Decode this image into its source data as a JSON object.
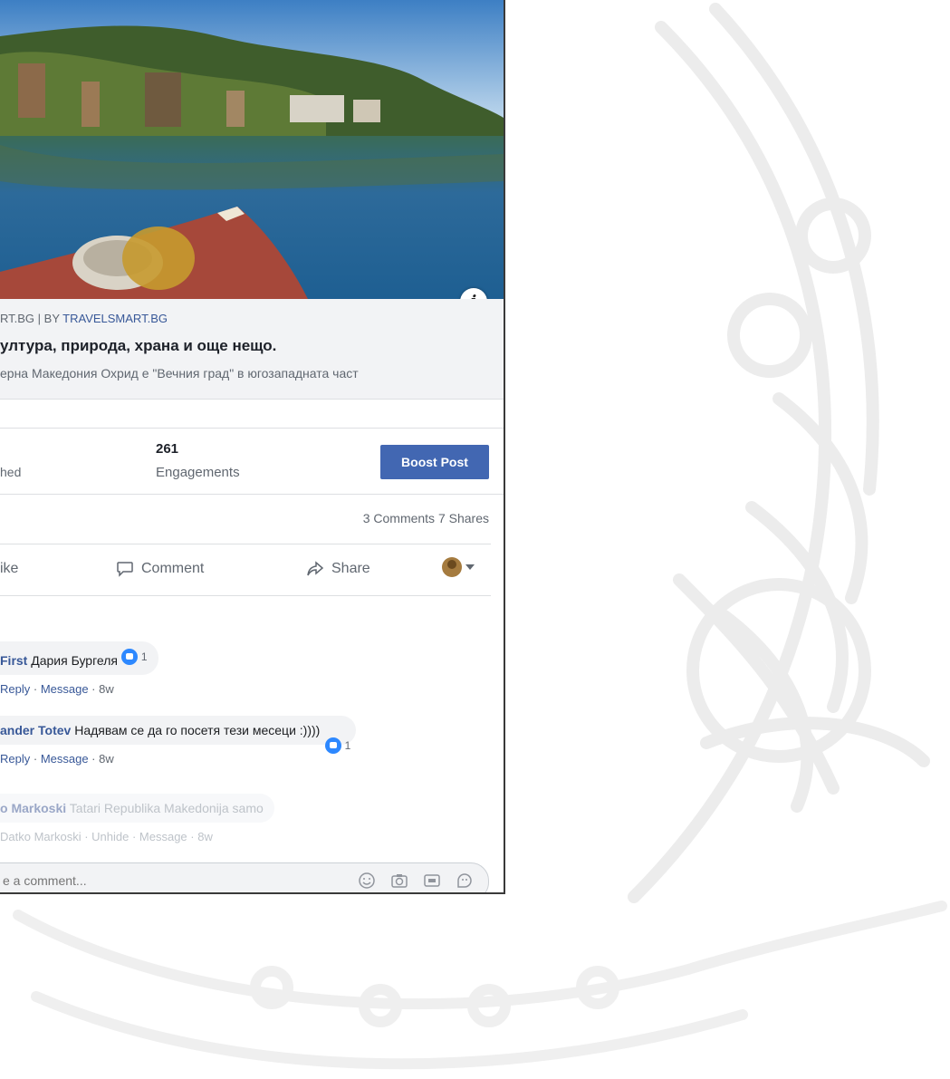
{
  "post": {
    "link_source_prefix": "RT.BG | BY",
    "link_source_name": "TRAVELSMART.BG",
    "link_title": "ултура, природа, храна и още нещо.",
    "link_description": "ерна Македония Охрид е \"Вечния град\" в югозападната част",
    "info_label": "i"
  },
  "stats": {
    "left_label": "hed",
    "engagements_value": "261",
    "engagements_label": "Engagements",
    "boost_label": "Boost Post",
    "counts": "3 Comments  7 Shares"
  },
  "actions": {
    "like": "ike",
    "comment": "Comment",
    "share": "Share"
  },
  "comments": [
    {
      "author": "First",
      "text": "Дария Бургеля",
      "reactions": "1",
      "actions": [
        "Reply",
        "Message",
        "8w"
      ]
    },
    {
      "author": "ander Totev",
      "text": "Надявам се да го посетя тези месеци :))))",
      "reactions": "1",
      "actions": [
        "Reply",
        "Message",
        "8w"
      ]
    },
    {
      "author": "o Markoski",
      "text": "Tatari Republika Makedonija samo",
      "actions": [
        "Datko Markoski",
        "Unhide",
        "Message",
        "8w"
      ]
    }
  ],
  "composer": {
    "placeholder": "e a comment..."
  },
  "colors": {
    "accent": "#4267b2",
    "link": "#385898",
    "like": "#2d88ff"
  }
}
